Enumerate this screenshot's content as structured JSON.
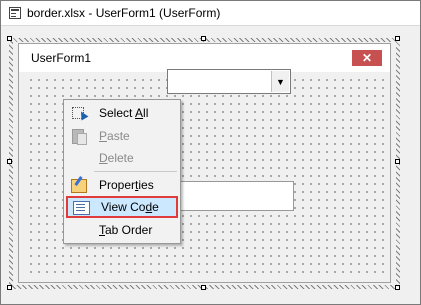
{
  "window": {
    "title": "border.xlsx - UserForm1 (UserForm)"
  },
  "form": {
    "caption": "UserForm1",
    "close_glyph": "✕"
  },
  "combo": {
    "dropdown_glyph": "▼"
  },
  "context_menu": {
    "items": [
      {
        "label": "Select All",
        "accel_char": "A",
        "icon": "select-all-icon",
        "enabled": true
      },
      {
        "label": "Paste",
        "accel_char": "P",
        "icon": "paste-icon",
        "enabled": false
      },
      {
        "label": "Delete",
        "accel_char": "D",
        "icon": "",
        "enabled": false
      },
      {
        "label": "Properties",
        "accel_char": "t",
        "icon": "properties-icon",
        "enabled": true
      },
      {
        "label": "View Code",
        "accel_char": "d",
        "icon": "view-code-icon",
        "enabled": true,
        "highlighted": true
      },
      {
        "label": "Tab Order",
        "accel_char": "T",
        "icon": "",
        "enabled": true
      }
    ]
  },
  "colors": {
    "highlight_fill": "#cce8ff",
    "highlight_border": "#e03c3c",
    "close_button": "#c75050"
  }
}
